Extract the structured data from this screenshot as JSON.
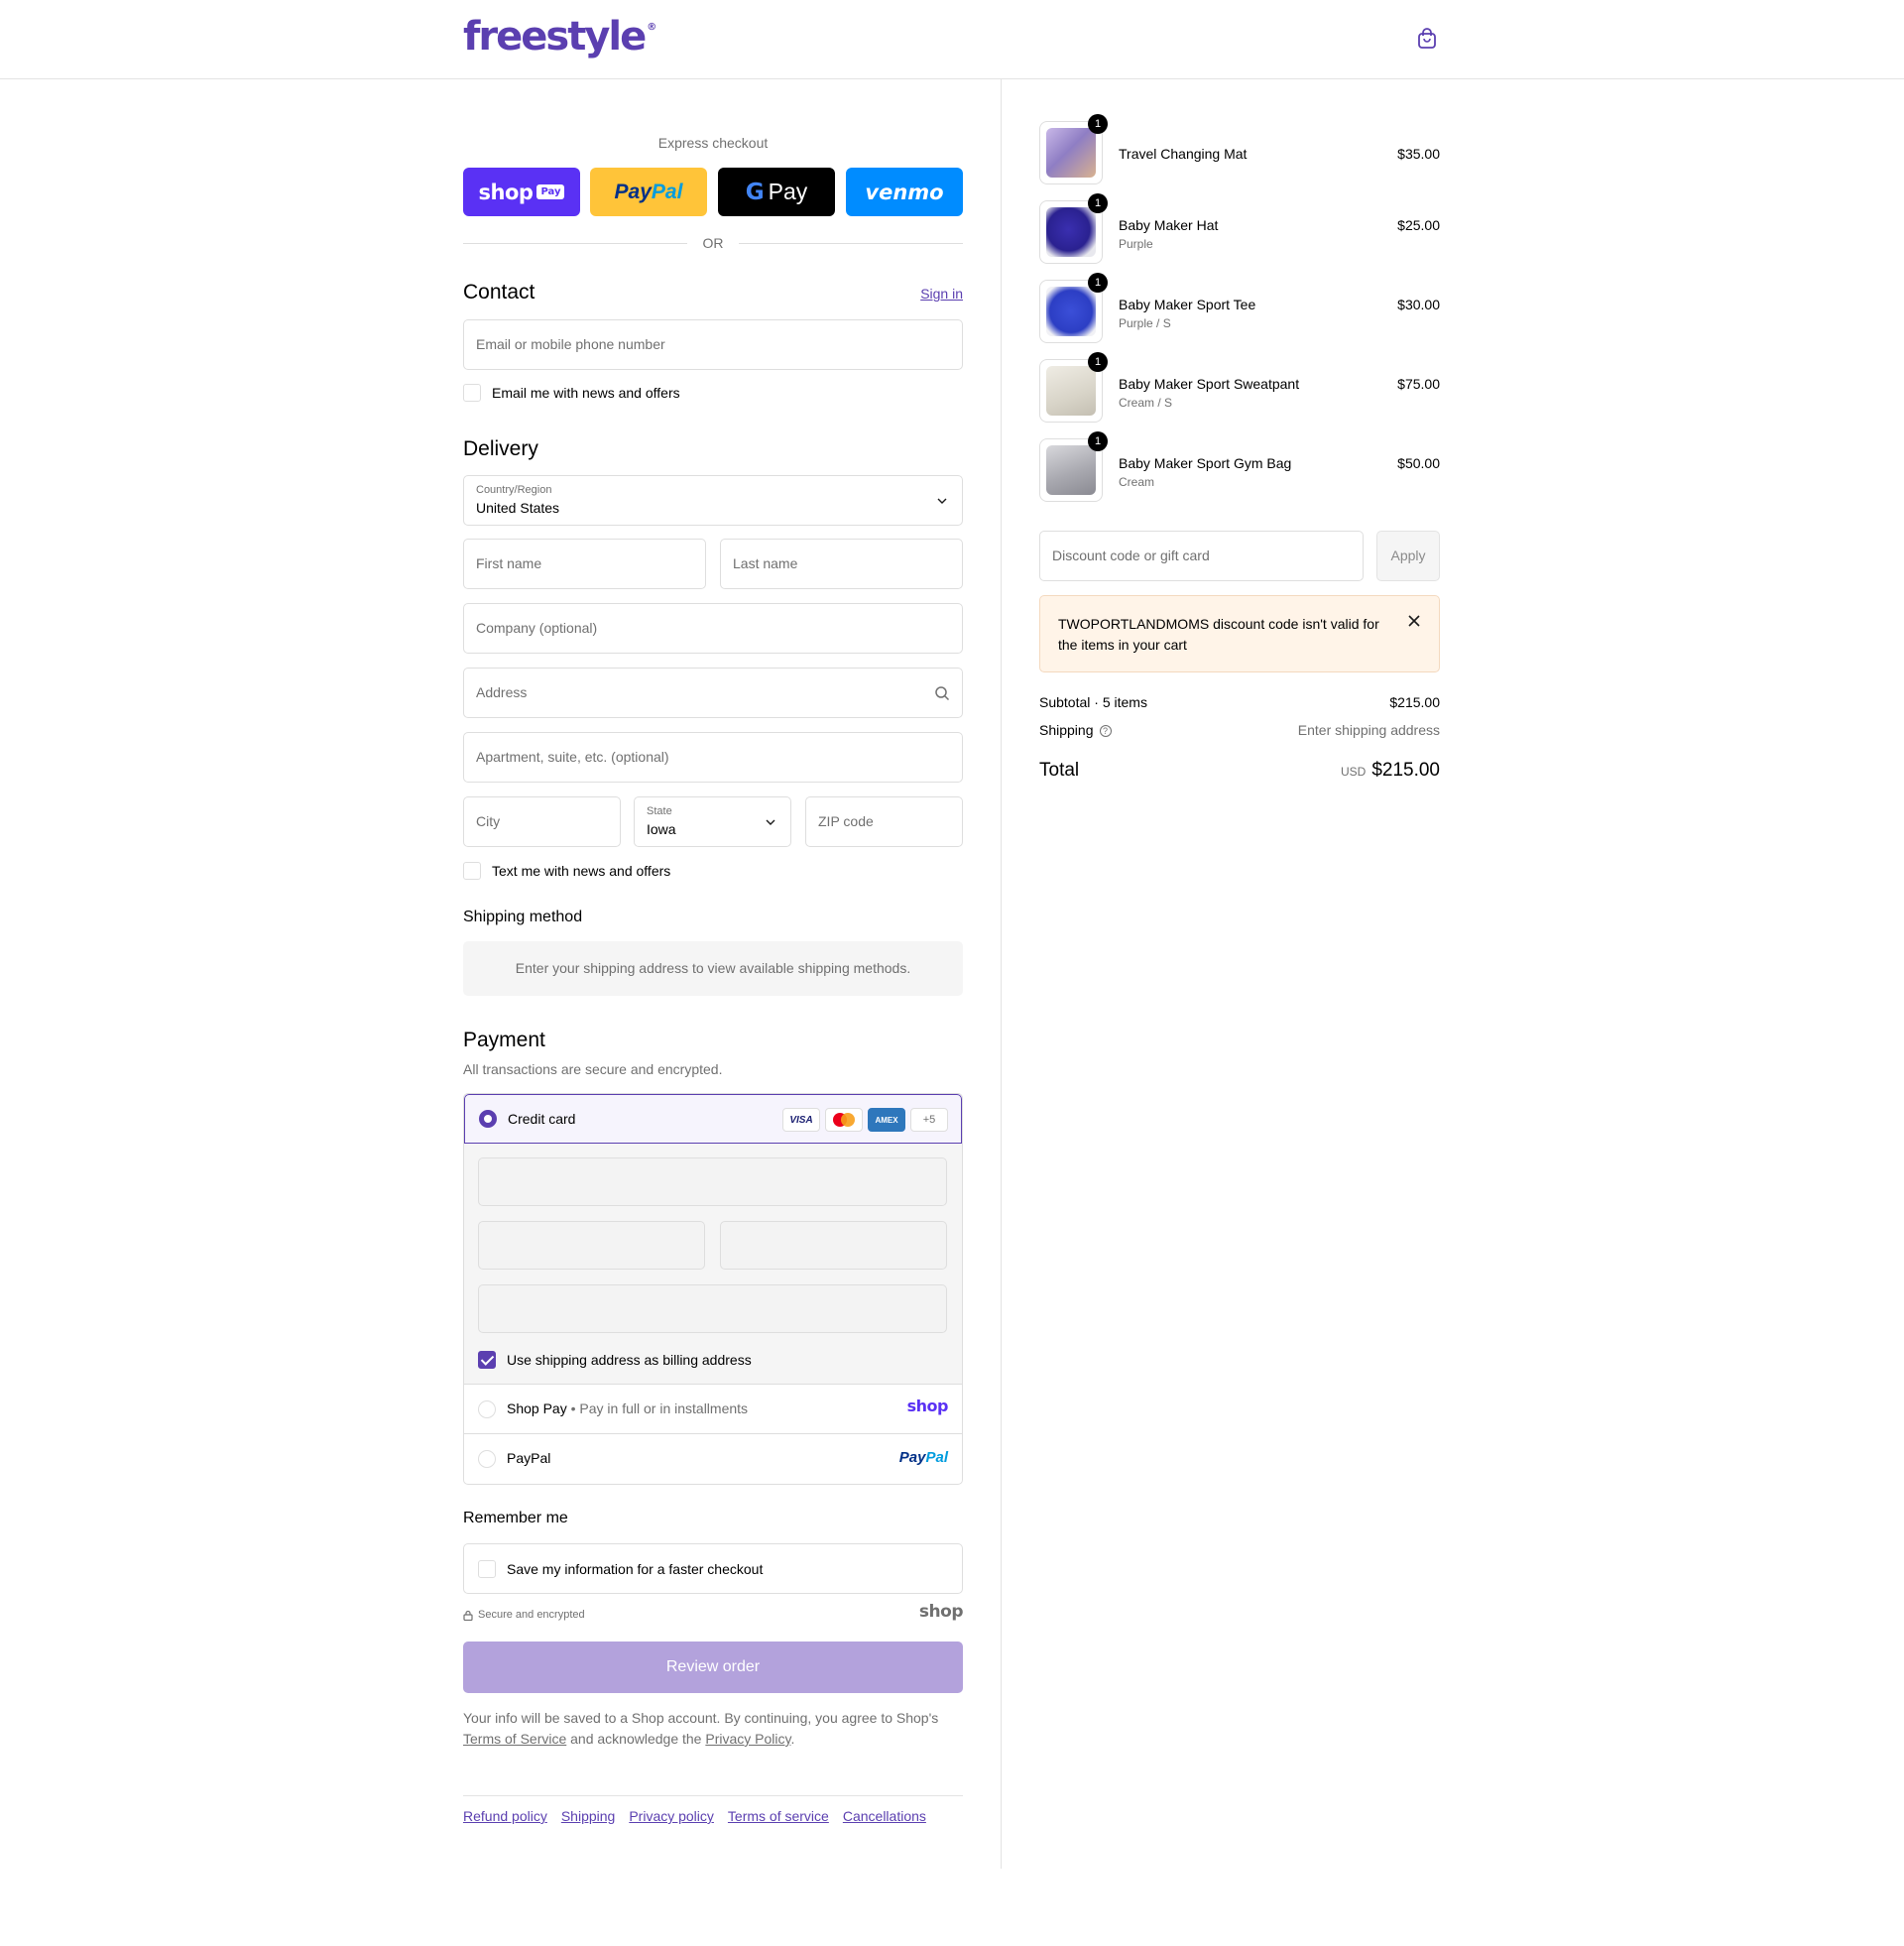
{
  "header": {
    "logo": "freestyle",
    "logo_mark": "®"
  },
  "express": {
    "title": "Express checkout",
    "shop_pay_label": "shop",
    "shop_pay_tag": "Pay",
    "paypal_left": "Pay",
    "paypal_right": "Pal",
    "gpay_g": "G",
    "gpay_label": "Pay",
    "venmo_label": "venmo",
    "or": "OR"
  },
  "contact": {
    "title": "Contact",
    "sign_in": "Sign in",
    "email_placeholder": "Email or mobile phone number",
    "news_label": "Email me with news and offers"
  },
  "delivery": {
    "title": "Delivery",
    "country_label": "Country/Region",
    "country_value": "United States",
    "first_name": "First name",
    "last_name": "Last name",
    "company": "Company (optional)",
    "address": "Address",
    "apartment": "Apartment, suite, etc. (optional)",
    "city": "City",
    "state_label": "State",
    "state_value": "Iowa",
    "zip": "ZIP code",
    "text_label": "Text me with news and offers"
  },
  "shipping_method": {
    "title": "Shipping method",
    "notice": "Enter your shipping address to view available shipping methods."
  },
  "payment": {
    "title": "Payment",
    "subtitle": "All transactions are secure and encrypted.",
    "credit_card": "Credit card",
    "cards": [
      "VISA",
      "",
      "AMEX",
      "+5"
    ],
    "billing_label": "Use shipping address as billing address",
    "shop_pay": "Shop Pay",
    "shop_pay_sub": "Pay in full or in installments",
    "shop_wordmark": "shop",
    "paypal": "PayPal",
    "paypal_logo_left": "Pay",
    "paypal_logo_right": "Pal"
  },
  "remember": {
    "title": "Remember me",
    "save_label": "Save my information for a faster checkout",
    "secure": "Secure and encrypted",
    "shop_wordmark": "shop"
  },
  "review_button": "Review order",
  "legal": {
    "part1": "Your info will be saved to a Shop account. By continuing, you agree to Shop's",
    "terms": "Terms of Service",
    "part2": "and acknowledge the",
    "privacy": "Privacy Policy",
    "end": "."
  },
  "footer_links": [
    "Refund policy",
    "Shipping",
    "Privacy policy",
    "Terms of service",
    "Cancellations"
  ],
  "cart": {
    "items": [
      {
        "name": "Travel Changing Mat",
        "variant": "",
        "price": "$35.00",
        "qty": "1"
      },
      {
        "name": "Baby Maker Hat",
        "variant": "Purple",
        "price": "$25.00",
        "qty": "1"
      },
      {
        "name": "Baby Maker Sport Tee",
        "variant": "Purple / S",
        "price": "$30.00",
        "qty": "1"
      },
      {
        "name": "Baby Maker Sport Sweatpant",
        "variant": "Cream / S",
        "price": "$75.00",
        "qty": "1"
      },
      {
        "name": "Baby Maker Sport Gym Bag",
        "variant": "Cream",
        "price": "$50.00",
        "qty": "1"
      }
    ],
    "discount_placeholder": "Discount code or gift card",
    "apply": "Apply",
    "error": "TWOPORTLANDMOMS discount code isn't valid for the items in your cart",
    "subtotal_label": "Subtotal · 5 items",
    "subtotal_value": "$215.00",
    "shipping_label": "Shipping",
    "shipping_value": "Enter shipping address",
    "total_label": "Total",
    "currency": "USD",
    "total_value": "$215.00"
  },
  "colors": {
    "accent": "#5b3fb0",
    "review_button": "#b3a2dc",
    "error_bg": "#fff4e8"
  },
  "icons": {
    "cart": "shopping-bag-icon",
    "search": "search-icon",
    "chevron": "chevron-down-icon",
    "close": "close-icon",
    "help": "question-circle-icon",
    "lock": "lock-icon"
  }
}
